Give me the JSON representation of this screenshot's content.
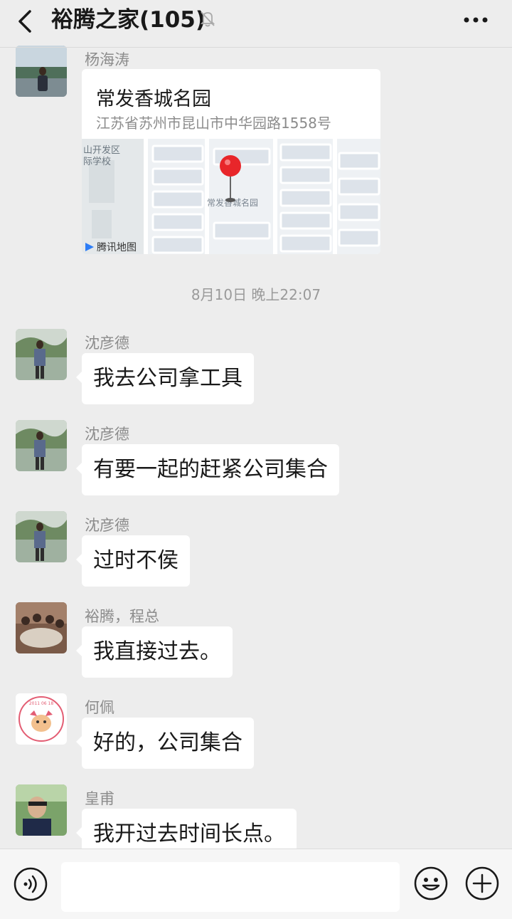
{
  "header": {
    "title": "裕腾之家(105)"
  },
  "location": {
    "sender": "杨海涛",
    "name": "常发香城名园",
    "address": "江苏省苏州市昆山市中华园路1558号",
    "map_labels": [
      "山开发区",
      "际学校",
      "常发香城名园"
    ],
    "map_provider": "腾讯地图"
  },
  "timestamp": "8月10日 晚上22:07",
  "messages": [
    {
      "sender": "沈彦德",
      "text": "我去公司拿工具"
    },
    {
      "sender": "沈彦德",
      "text": "有要一起的赶紧公司集合"
    },
    {
      "sender": "沈彦德",
      "text": "过时不侯"
    },
    {
      "sender": "裕腾，程总",
      "text": "我直接过去。"
    },
    {
      "sender": "何佩",
      "text": "好的，公司集合"
    },
    {
      "sender": "皇甫",
      "text": "我开过去时间长点。"
    }
  ],
  "avatar_badge_text": "2011 06 18",
  "icons": {
    "back": "chevron-left-icon",
    "mute": "bell-off-icon",
    "more": "more-dots-icon",
    "voice": "voice-icon",
    "emoji": "emoji-icon",
    "plus": "plus-icon"
  },
  "colors": {
    "background": "#ededed",
    "bubble": "#ffffff",
    "pin": "#e8262a"
  }
}
